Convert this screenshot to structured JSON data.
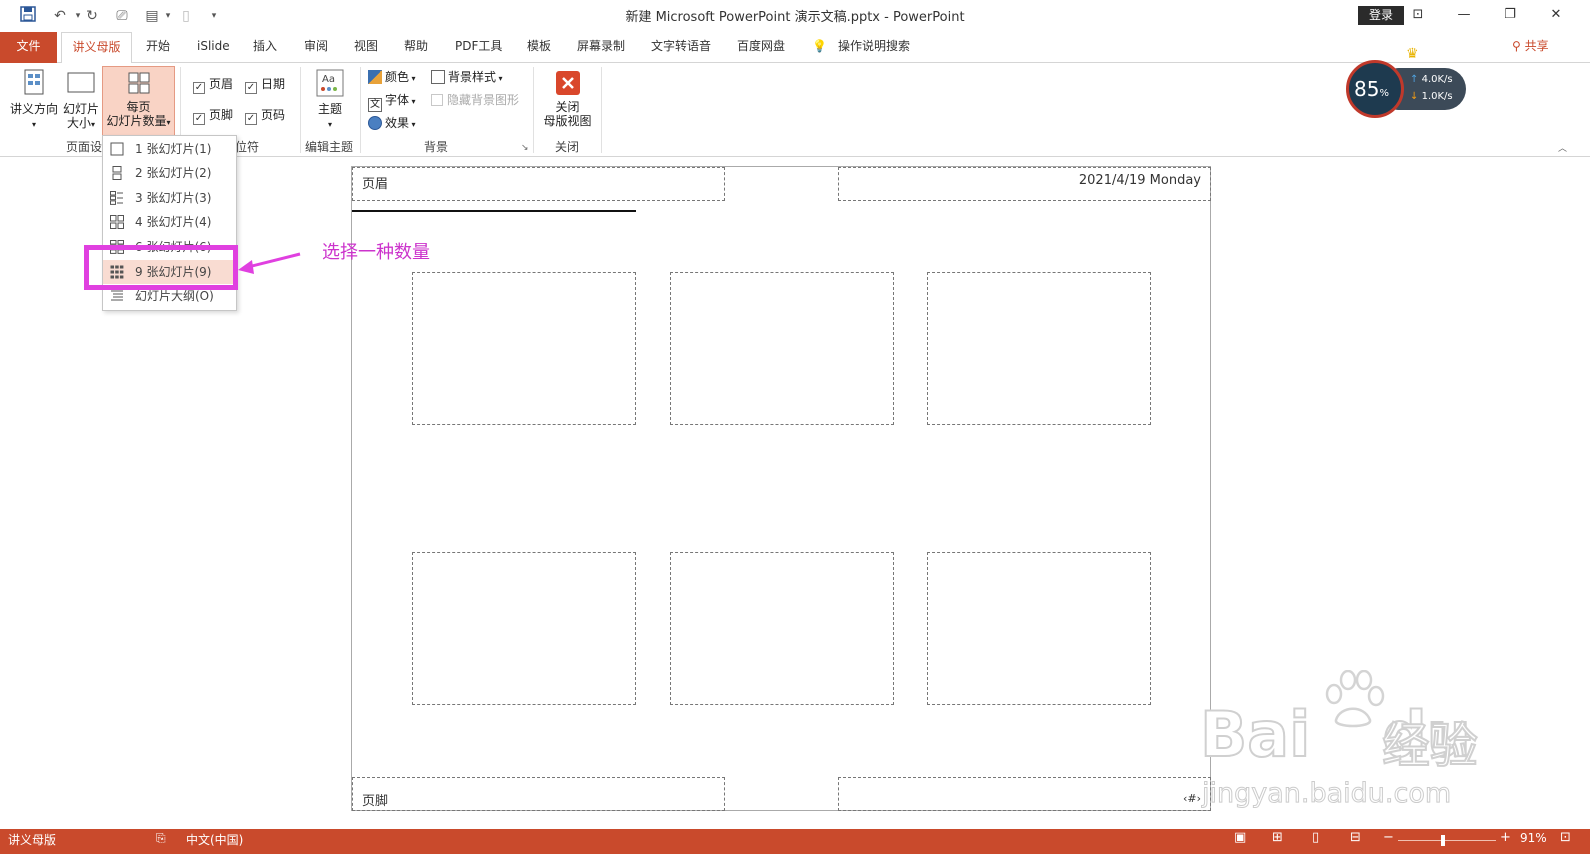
{
  "titlebar": {
    "title": "新建 Microsoft PowerPoint 演示文稿.pptx  -  PowerPoint",
    "login": "登录"
  },
  "tabs": [
    "文件",
    "讲义母版",
    "开始",
    "iSlide",
    "插入",
    "审阅",
    "视图",
    "帮助",
    "PDF工具",
    "模板",
    "屏幕录制",
    "文字转语音",
    "百度网盘"
  ],
  "tell_me": "操作说明搜索",
  "share": "共享",
  "ribbon": {
    "handout_orientation": "讲义方向",
    "slide_size_1": "幻灯片",
    "slide_size_2": "大小",
    "slides_per_page_1": "每页",
    "slides_per_page_2": "幻灯片数量",
    "header_chk": "页眉",
    "date_chk": "日期",
    "footer_chk": "页脚",
    "page_num_chk": "页码",
    "theme": "主题",
    "colors": "颜色",
    "fonts": "字体",
    "effects": "效果",
    "bg_styles": "背景样式",
    "hide_bg": "隐藏背景图形",
    "close_1": "关闭",
    "close_2": "母版视图",
    "grp_page_setup": "页面设",
    "grp_placeholders": "位符",
    "grp_edit_theme": "编辑主题",
    "grp_background": "背景",
    "grp_close": "关闭"
  },
  "menu": {
    "items": [
      "1 张幻灯片(1)",
      "2 张幻灯片(2)",
      "3 张幻灯片(3)",
      "4 张幻灯片(4)",
      "6 张幻灯片(6)",
      "9 张幻灯片(9)",
      "幻灯片大纲(O)"
    ]
  },
  "annotation": "选择一种数量",
  "canvas": {
    "header": "页眉",
    "date": "2021/4/19 Monday",
    "footer": "页脚",
    "page_num": "‹#›"
  },
  "speed": {
    "percent": "85",
    "percent_sign": "%",
    "up": "4.0",
    "up_unit": "K/s",
    "down": "1.0",
    "down_unit": "K/s"
  },
  "status": {
    "mode": "讲义母版",
    "lang": "中文(中国)",
    "zoom": "91%"
  },
  "watermark": {
    "brand": "Bai",
    "brand2": "du",
    "cn": "经验",
    "url": "jingyan.baidu.com"
  },
  "colors": {
    "accent": "#c94a2c",
    "highlight": "#e040e0"
  }
}
